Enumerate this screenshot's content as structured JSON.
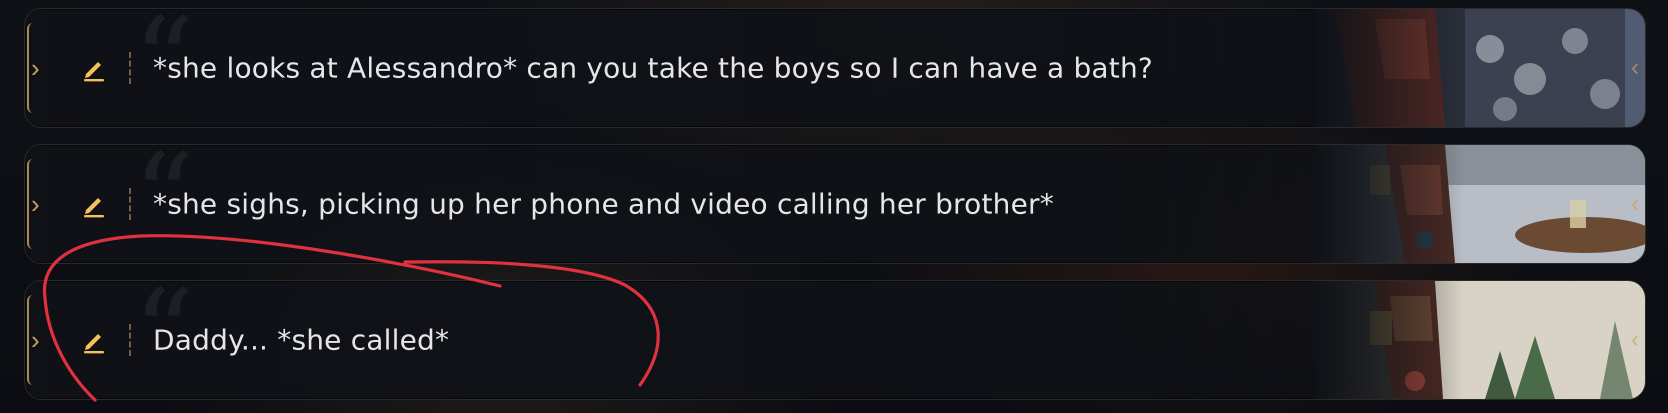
{
  "messages": [
    {
      "text": "*she looks at Alessandro* can you take the boys so I can have a bath?"
    },
    {
      "text": "*she sighs, picking up her phone and video calling her brother*"
    },
    {
      "text": "Daddy... *she called*"
    }
  ],
  "colors": {
    "accent_gold": "#c9a25f",
    "edit_icon": "#f4c15a",
    "annotation_red": "#e0313f",
    "text": "#e6e6e8"
  },
  "icons": {
    "edit": "pencil-icon",
    "expand": "chevron-right-icon",
    "collapse": "chevron-left-icon",
    "quote": "quote-mark-icon"
  }
}
